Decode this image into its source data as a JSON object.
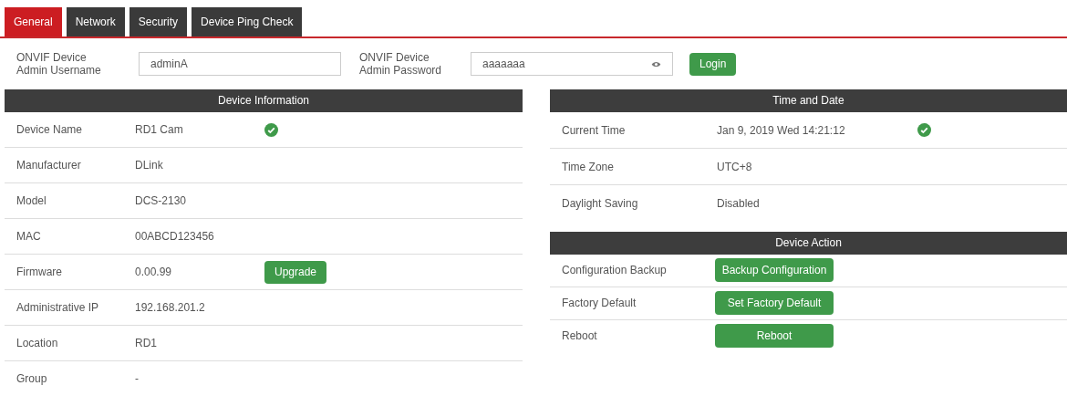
{
  "tabs": [
    {
      "label": "General",
      "selected": true
    },
    {
      "label": "Network",
      "selected": false
    },
    {
      "label": "Security",
      "selected": false
    },
    {
      "label": "Device Ping Check",
      "selected": false
    }
  ],
  "login": {
    "username_label": "ONVIF Device Admin Username",
    "username": "adminA",
    "password_label": "ONVIF Device Admin Password",
    "password": "aaaaaaa",
    "button": "Login"
  },
  "device_information": {
    "title": "Device Information",
    "rows": [
      {
        "label": "Device Name",
        "value": "RD1 Cam",
        "kind": "check"
      },
      {
        "label": "Manufacturer",
        "value": "DLink",
        "kind": "text"
      },
      {
        "label": "Model",
        "value": "DCS-2130",
        "kind": "text"
      },
      {
        "label": "MAC",
        "value": "00ABCD123456",
        "kind": "text"
      },
      {
        "label": "Firmware",
        "value": "0.00.99",
        "kind": "button",
        "button": "Upgrade"
      },
      {
        "label": "Administrative IP",
        "value": "192.168.201.2",
        "kind": "text"
      },
      {
        "label": "Location",
        "value": "RD1",
        "kind": "text"
      },
      {
        "label": "Group",
        "value": "-",
        "kind": "text"
      }
    ]
  },
  "time_and_date": {
    "title": "Time and Date",
    "rows": [
      {
        "label": "Current Time",
        "value": "Jan 9, 2019 Wed 14:21:12",
        "kind": "check"
      },
      {
        "label": "Time Zone",
        "value": "UTC+8",
        "kind": "text"
      },
      {
        "label": "Daylight Saving",
        "value": "Disabled",
        "kind": "text"
      }
    ]
  },
  "device_action": {
    "title": "Device Action",
    "rows": [
      {
        "label": "Configuration Backup",
        "button": "Backup Configuration"
      },
      {
        "label": "Factory Default",
        "button": "Set Factory Default"
      },
      {
        "label": "Reboot",
        "button": "Reboot"
      }
    ]
  }
}
